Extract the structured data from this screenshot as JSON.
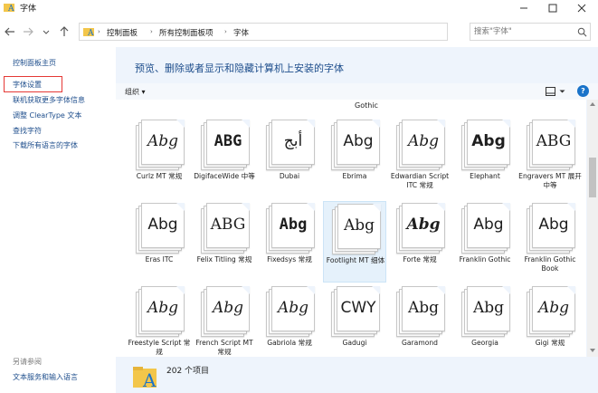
{
  "window": {
    "title": "字体",
    "accent": "#1e4e8c"
  },
  "nav": {
    "breadcrumb": [
      "控制面板",
      "所有控制面板项",
      "字体"
    ],
    "search_placeholder": "搜索\"字体\""
  },
  "sidebar": {
    "links": [
      {
        "label": "控制面板主页"
      },
      {
        "label": "字体设置",
        "highlighted": true
      },
      {
        "label": "联机获取更多字体信息"
      },
      {
        "label": "调整 ClearType 文本"
      },
      {
        "label": "查找字符"
      },
      {
        "label": "下载所有语言的字体"
      }
    ],
    "see_also_title": "另请参阅",
    "see_also_link": "文本服务和输入语言"
  },
  "main": {
    "heading": "预览、删除或者显示和隐藏计算机上安装的字体",
    "organize_label": "组织",
    "partial_label": "Gothic",
    "fonts": [
      {
        "name": "Curlz MT 常规",
        "sample": "Abg",
        "style": "script"
      },
      {
        "name": "DigifaceWide 中等",
        "sample": "ABG",
        "style": "mono"
      },
      {
        "name": "Dubai",
        "sample": "أبج",
        "style": "sans"
      },
      {
        "name": "Ebrima",
        "sample": "Abg",
        "style": "sans"
      },
      {
        "name": "Edwardian Script ITC 常规",
        "sample": "Abg",
        "style": "script"
      },
      {
        "name": "Elephant",
        "sample": "Abg",
        "style": "bold"
      },
      {
        "name": "Engravers MT 展开 中等",
        "sample": "ABG",
        "style": "serif"
      },
      {
        "name": "Eras ITC",
        "sample": "Abg",
        "style": "sans"
      },
      {
        "name": "Felix Titling 常规",
        "sample": "ABG",
        "style": "serif"
      },
      {
        "name": "Fixedsys 常规",
        "sample": "Abg",
        "style": "mono"
      },
      {
        "name": "Footlight MT 细体",
        "sample": "Abg",
        "style": "serif",
        "selected": true
      },
      {
        "name": "Forte 常规",
        "sample": "Abg",
        "style": "script-bold"
      },
      {
        "name": "Franklin Gothic",
        "sample": "Abg",
        "style": "sans"
      },
      {
        "name": "Franklin Gothic Book",
        "sample": "Abg",
        "style": "sans"
      },
      {
        "name": "Freestyle Script 常规",
        "sample": "Abg",
        "style": "script"
      },
      {
        "name": "French Script MT 常规",
        "sample": "Abg",
        "style": "script"
      },
      {
        "name": "Gabriola 常规",
        "sample": "Abg",
        "style": "script"
      },
      {
        "name": "Gadugi",
        "sample": "CWY",
        "style": "sans"
      },
      {
        "name": "Garamond",
        "sample": "Abg",
        "style": "serif"
      },
      {
        "name": "Georgia",
        "sample": "Abg",
        "style": "serif"
      },
      {
        "name": "Gigi 常规",
        "sample": "Abg",
        "style": "script"
      }
    ]
  },
  "details": {
    "count_text": "202 个项目"
  }
}
